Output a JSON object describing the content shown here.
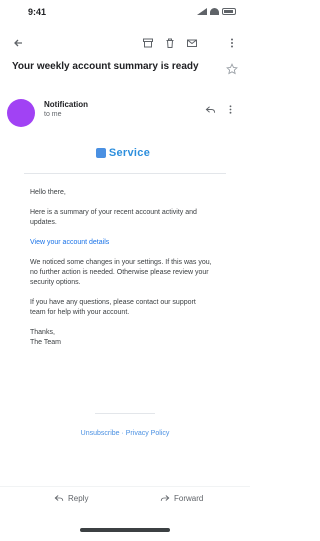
{
  "status_bar": {
    "time": "9:41"
  },
  "toolbar": {
    "back_icon": "arrow-left-icon",
    "archive_icon": "archive-icon",
    "delete_icon": "trash-icon",
    "mail_icon": "mail-icon",
    "more_icon": "more-vert-icon"
  },
  "email": {
    "subject": "Your weekly account summary is ready",
    "sender_name": "Notification",
    "sender_meta": "to me",
    "brand": "Service",
    "paragraphs": [
      "Hello there,",
      "Here is a summary of your recent account activity and updates.",
      "View your account details",
      "We noticed some changes in your settings. If this was you, no further action is needed. Otherwise please review your security options.",
      "If you have any questions, please contact our support team for help with your account.",
      "Thanks,",
      "The Team"
    ],
    "footer_link": "Unsubscribe · Privacy Policy"
  },
  "actions": {
    "reply": "Reply",
    "forward": "Forward"
  },
  "colors": {
    "avatar": "#a142f4",
    "brand": "#2d8fdd",
    "link": "#1a73e8"
  }
}
